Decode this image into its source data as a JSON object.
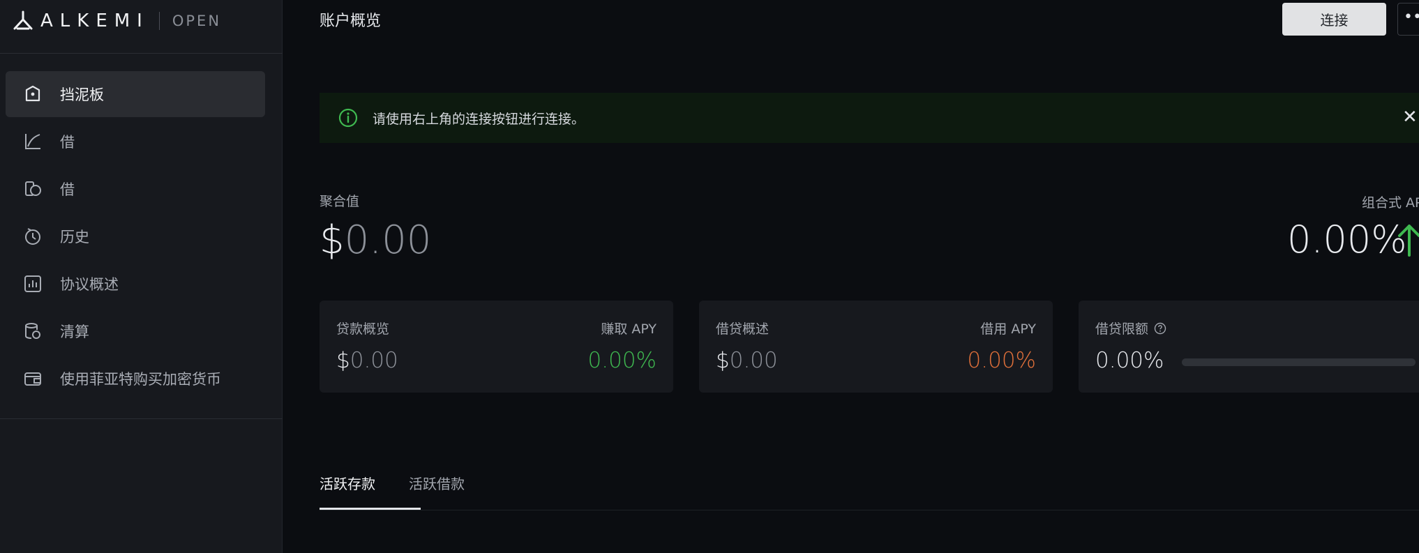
{
  "brand": {
    "name": "ALKEMI",
    "edition": "OPEN"
  },
  "sidebar": {
    "items": [
      {
        "label": "挡泥板",
        "icon": "dashboard-icon",
        "active": true
      },
      {
        "label": "借",
        "icon": "curve-chart-icon",
        "active": false
      },
      {
        "label": "借",
        "icon": "coins-icon",
        "active": false
      },
      {
        "label": "历史",
        "icon": "history-icon",
        "active": false
      },
      {
        "label": "协议概述",
        "icon": "bar-chart-icon",
        "active": false
      },
      {
        "label": "清算",
        "icon": "liquidation-icon",
        "active": false
      },
      {
        "label": "使用菲亚特购买加密货币",
        "icon": "wallet-icon",
        "active": false
      }
    ]
  },
  "header": {
    "title": "账户概览",
    "connect_label": "连接",
    "more_label": "•••"
  },
  "alert": {
    "text": "请使用右上角的连接按钮进行连接。",
    "close": "✕"
  },
  "summary": {
    "aggregate_label": "聚合值",
    "aggregate_currency": "$",
    "aggregate_amount": "0.00",
    "apy_label": "组合式 AP",
    "apy_value": "0.00%"
  },
  "cards": {
    "deposit": {
      "title": "贷款概览",
      "right_label": "赚取 APY",
      "currency": "$",
      "amount": "0.00",
      "pct": "0.00%"
    },
    "borrow": {
      "title": "借贷概述",
      "right_label": "借用 APY",
      "currency": "$",
      "amount": "0.00",
      "pct": "0.00%"
    },
    "limit": {
      "title": "借贷限额",
      "pct": "0.00%",
      "fill": 0
    }
  },
  "tabs": [
    {
      "label": "活跃存款",
      "active": true
    },
    {
      "label": "活跃借款",
      "active": false
    }
  ],
  "colors": {
    "accent_green": "#3fb950",
    "accent_orange": "#e0703a",
    "sidebar_bg": "#17191e",
    "page_bg": "#0b0d11"
  }
}
